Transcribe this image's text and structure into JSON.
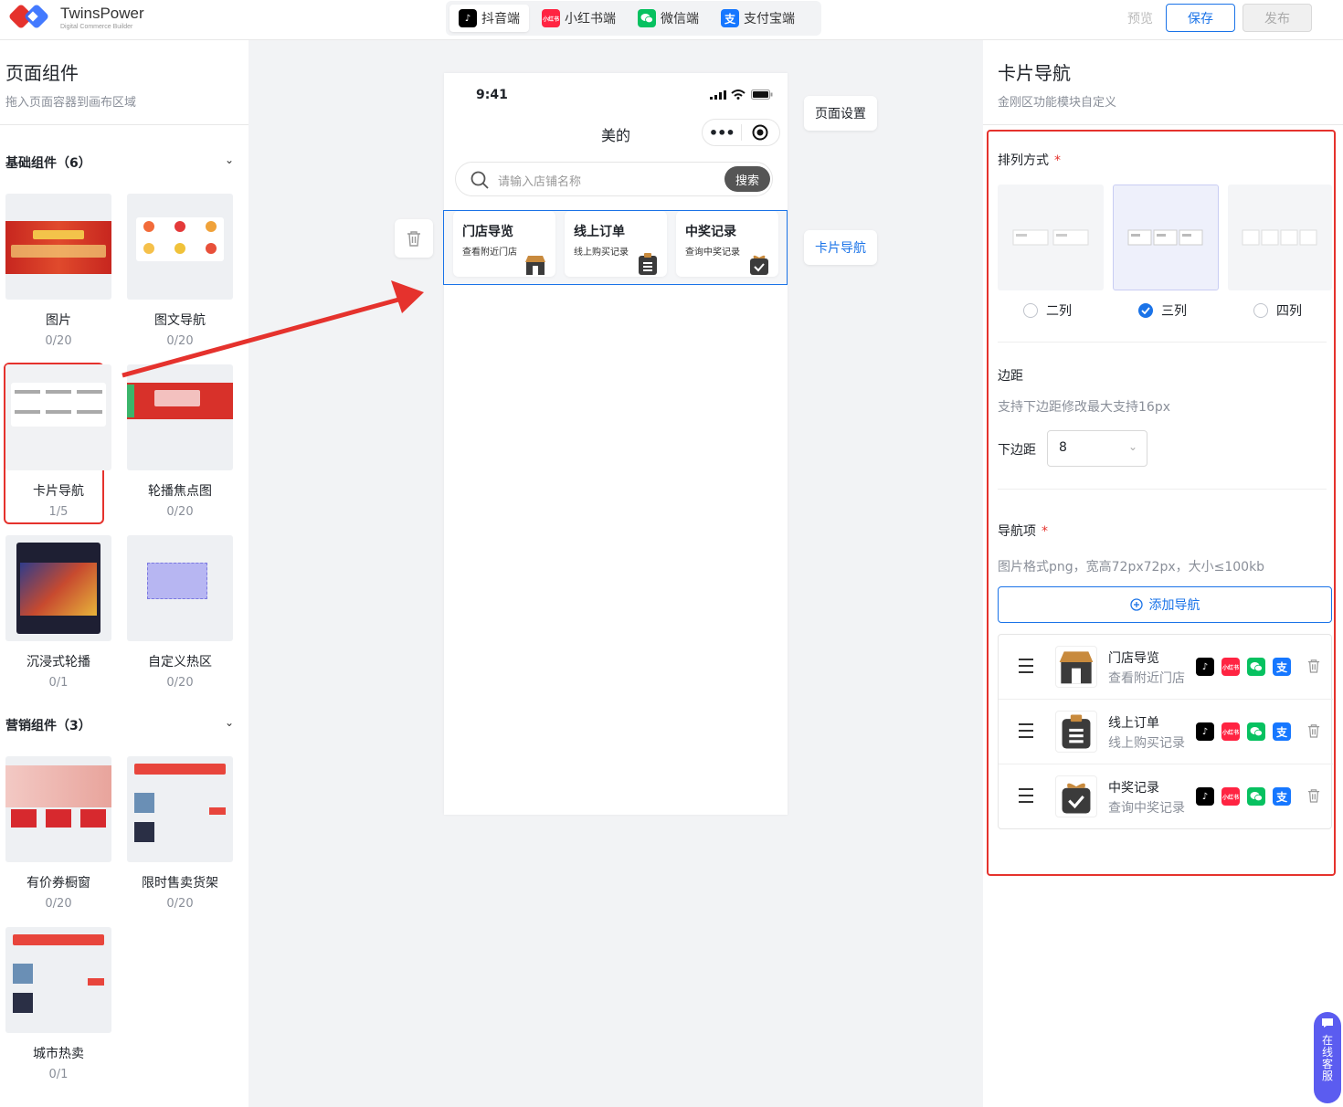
{
  "brand": {
    "name": "TwinsPower",
    "subtitle": "Digital Commerce Builder"
  },
  "platforms": [
    {
      "label": "抖音端",
      "icon": "douyin-icon",
      "color": "#000000"
    },
    {
      "label": "小红书端",
      "icon": "xiaohongshu-icon",
      "color": "#ff2442",
      "badge": "小红书"
    },
    {
      "label": "微信端",
      "icon": "wechat-icon",
      "color": "#07c160"
    },
    {
      "label": "支付宝端",
      "icon": "alipay-icon",
      "color": "#1677ff",
      "badge": "支"
    }
  ],
  "actions": {
    "preview": "预览",
    "save": "保存",
    "publish": "发布"
  },
  "left": {
    "title": "页面组件",
    "desc": "拖入页面容器到画布区域",
    "groups": [
      {
        "title": "基础组件（6）",
        "items": [
          {
            "name": "图片",
            "count": "0/20"
          },
          {
            "name": "图文导航",
            "count": "0/20"
          },
          {
            "name": "卡片导航",
            "count": "1/5"
          },
          {
            "name": "轮播焦点图",
            "count": "0/20"
          },
          {
            "name": "沉浸式轮播",
            "count": "0/1"
          },
          {
            "name": "自定义热区",
            "count": "0/20"
          }
        ]
      },
      {
        "title": "营销组件（3）",
        "items": [
          {
            "name": "有价券橱窗",
            "count": "0/20"
          },
          {
            "name": "限时售卖货架",
            "count": "0/20"
          },
          {
            "name": "城市热卖",
            "count": "0/1"
          }
        ]
      }
    ]
  },
  "phone": {
    "time": "9:41",
    "title": "美的",
    "capsule_more": "•••",
    "search_placeholder": "请输入店铺名称",
    "search_button": "搜索",
    "cards": [
      {
        "title": "门店导览",
        "sub": "查看附近门店"
      },
      {
        "title": "线上订单",
        "sub": "线上购买记录"
      },
      {
        "title": "中奖记录",
        "sub": "查询中奖记录"
      }
    ]
  },
  "canvas_tags": {
    "page_settings": "页面设置",
    "card_nav": "卡片导航"
  },
  "right": {
    "title": "卡片导航",
    "desc": "金刚区功能模块自定义",
    "layout_label": "排列方式",
    "layout_options": [
      "二列",
      "三列",
      "四列"
    ],
    "layout_selected": "三列",
    "margin_label": "边距",
    "margin_hint": "支持下边距修改最大支持16px",
    "bottom_margin_label": "下边距",
    "bottom_margin_value": "8",
    "nav_label": "导航项",
    "nav_hint": "图片格式png，宽高72px72px，大小≤100kb",
    "add_nav": "添加导航",
    "nav_items": [
      {
        "title": "门店导览",
        "sub": "查看附近门店"
      },
      {
        "title": "线上订单",
        "sub": "线上购买记录"
      },
      {
        "title": "中奖记录",
        "sub": "查询中奖记录"
      }
    ]
  },
  "chat": "在线客服",
  "colors": {
    "accent": "#1a73e8",
    "highlight": "#e5322d",
    "chat": "#5b5cf0"
  }
}
